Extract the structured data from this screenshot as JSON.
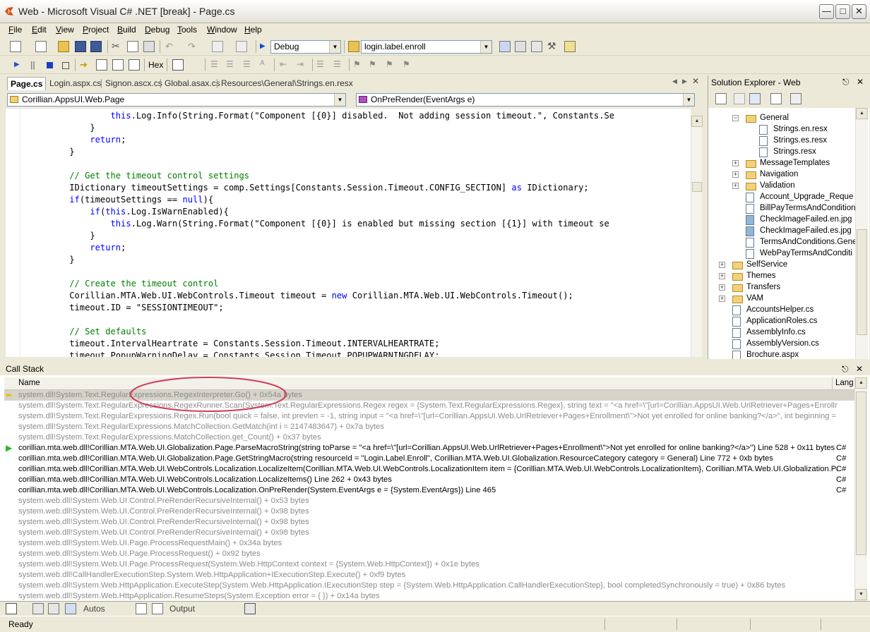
{
  "window": {
    "title": "Web - Microsoft Visual C# .NET [break] - Page.cs"
  },
  "menu": [
    {
      "label": "File",
      "u": "F",
      "rest": "ile"
    },
    {
      "label": "Edit",
      "u": "E",
      "rest": "dit"
    },
    {
      "label": "View",
      "u": "V",
      "rest": "iew"
    },
    {
      "label": "Project",
      "u": "P",
      "rest": "roject"
    },
    {
      "label": "Build",
      "u": "B",
      "rest": "uild"
    },
    {
      "label": "Debug",
      "u": "D",
      "rest": "ebug"
    },
    {
      "label": "Tools",
      "u": "T",
      "rest": "ools"
    },
    {
      "label": "Window",
      "u": "W",
      "rest": "indow"
    },
    {
      "label": "Help",
      "u": "H",
      "rest": "elp"
    }
  ],
  "toolbar": {
    "config_value": "Debug",
    "find_value": "login.label.enroll",
    "hex_label": "Hex"
  },
  "tabs": [
    "Page.cs",
    "Login.aspx.cs",
    "Signon.ascx.cs",
    "Global.asax.cs",
    "Resources\\General\\Strings.en.resx"
  ],
  "navbar": {
    "type_value": "Corillian.AppsUI.Web.Page",
    "member_value": "OnPreRender(EventArgs e)"
  },
  "code_lines": [
    [
      [
        "                ",
        ""
      ],
      [
        "this",
        "kw"
      ],
      [
        ".Log.Info(String.Format(\"Component [{0}] disabled.  Not adding session timeout.\", Constants.Se",
        ""
      ]
    ],
    [
      [
        "            }",
        ""
      ]
    ],
    [
      [
        "            ",
        ""
      ],
      [
        "return",
        "kw"
      ],
      [
        ";",
        ""
      ]
    ],
    [
      [
        "        }",
        ""
      ]
    ],
    [
      [
        "",
        ""
      ]
    ],
    [
      [
        "        ",
        ""
      ],
      [
        "// Get the timeout control settings",
        "cm"
      ]
    ],
    [
      [
        "        IDictionary timeoutSettings = comp.Settings[Constants.Session.Timeout.CONFIG_SECTION] ",
        ""
      ],
      [
        "as",
        "kw"
      ],
      [
        " IDictionary;",
        ""
      ]
    ],
    [
      [
        "        ",
        ""
      ],
      [
        "if",
        "kw"
      ],
      [
        "(timeoutSettings == ",
        ""
      ],
      [
        "null",
        "kw"
      ],
      [
        "){",
        ""
      ]
    ],
    [
      [
        "            ",
        ""
      ],
      [
        "if",
        "kw"
      ],
      [
        "(",
        ""
      ],
      [
        "this",
        "kw"
      ],
      [
        ".Log.IsWarnEnabled){",
        ""
      ]
    ],
    [
      [
        "                ",
        ""
      ],
      [
        "this",
        "kw"
      ],
      [
        ".Log.Warn(String.Format(\"Component [{0}] is enabled but missing section [{1}] with timeout se",
        ""
      ]
    ],
    [
      [
        "            }",
        ""
      ]
    ],
    [
      [
        "            ",
        ""
      ],
      [
        "return",
        "kw"
      ],
      [
        ";",
        ""
      ]
    ],
    [
      [
        "        }",
        ""
      ]
    ],
    [
      [
        "",
        ""
      ]
    ],
    [
      [
        "        ",
        ""
      ],
      [
        "// Create the timeout control",
        "cm"
      ]
    ],
    [
      [
        "        Corillian.MTA.Web.UI.WebControls.Timeout timeout = ",
        ""
      ],
      [
        "new",
        "kw"
      ],
      [
        " Corillian.MTA.Web.UI.WebControls.Timeout();",
        ""
      ]
    ],
    [
      [
        "        timeout.ID = \"SESSIONTIMEOUT\";",
        ""
      ]
    ],
    [
      [
        "",
        ""
      ]
    ],
    [
      [
        "        ",
        ""
      ],
      [
        "// Set defaults",
        "cm"
      ]
    ],
    [
      [
        "        timeout.IntervalHeartrate = Constants.Session.Timeout.INTERVALHEARTRATE;",
        ""
      ]
    ],
    [
      [
        "        timeout.PopupWarningDelay = Constants.Session.Timeout.POPUPWARNINGDELAY;",
        ""
      ]
    ]
  ],
  "solution_explorer": {
    "title": "Solution Explorer - Web",
    "items": [
      {
        "label": "General",
        "kind": "folder",
        "indent": 3,
        "exp": "minus"
      },
      {
        "label": "Strings.en.resx",
        "kind": "file",
        "indent": 4
      },
      {
        "label": "Strings.es.resx",
        "kind": "file",
        "indent": 4
      },
      {
        "label": "Strings.resx",
        "kind": "file",
        "indent": 4
      },
      {
        "label": "MessageTemplates",
        "kind": "folder",
        "indent": 3,
        "exp": "plus"
      },
      {
        "label": "Navigation",
        "kind": "folder",
        "indent": 3,
        "exp": "plus"
      },
      {
        "label": "Validation",
        "kind": "folder",
        "indent": 3,
        "exp": "plus"
      },
      {
        "label": "Account_Upgrade_Reque",
        "kind": "file",
        "indent": 3
      },
      {
        "label": "BillPayTermsAndCondition",
        "kind": "file",
        "indent": 3
      },
      {
        "label": "CheckImageFailed.en.jpg",
        "kind": "image",
        "indent": 3
      },
      {
        "label": "CheckImageFailed.es.jpg",
        "kind": "image",
        "indent": 3
      },
      {
        "label": "TermsAndConditions.Gene",
        "kind": "file",
        "indent": 3
      },
      {
        "label": "WebPayTermsAndConditi",
        "kind": "file",
        "indent": 3
      },
      {
        "label": "SelfService",
        "kind": "folder",
        "indent": 2,
        "exp": "plus"
      },
      {
        "label": "Themes",
        "kind": "folder",
        "indent": 2,
        "exp": "plus"
      },
      {
        "label": "Transfers",
        "kind": "folder",
        "indent": 2,
        "exp": "plus"
      },
      {
        "label": "VAM",
        "kind": "folder",
        "indent": 2,
        "exp": "plus"
      },
      {
        "label": "AccountsHelper.cs",
        "kind": "file",
        "indent": 2
      },
      {
        "label": "ApplicationRoles.cs",
        "kind": "file",
        "indent": 2
      },
      {
        "label": "AssemblyInfo.cs",
        "kind": "file",
        "indent": 2
      },
      {
        "label": "AssemblyVersion.cs",
        "kind": "file",
        "indent": 2
      },
      {
        "label": "Brochure.aspx",
        "kind": "file",
        "indent": 2
      }
    ]
  },
  "call_stack": {
    "title": "Call Stack",
    "col_name": "Name",
    "col_lang": "Lang",
    "rows": [
      {
        "text": "system.dll!System.Text.RegularExpressions.RegexInterpreter.Go() + 0x54a bytes",
        "lang": "",
        "style": "grey",
        "marker": "current"
      },
      {
        "text": "system.dll!System.Text.RegularExpressions.RegexRunner.Scan(System.Text.RegularExpressions.Regex regex = {System.Text.RegularExpressions.Regex}, string text = \"<a href=\\\"[url=Corillian.AppsUI.Web.UrlRetriever+Pages+Enrollme",
        "lang": "",
        "style": "grey"
      },
      {
        "text": "system.dll!System.Text.RegularExpressions.Regex.Run(bool quick = false, int prevlen = -1, string input = \"<a href=\\\"[url=Corillian.AppsUI.Web.UrlRetriever+Pages+Enrollment\\\">Not yet enrolled for online banking?</a>\", int beginning = 0",
        "lang": "",
        "style": "grey"
      },
      {
        "text": "system.dll!System.Text.RegularExpressions.MatchCollection.GetMatch(int i = 2147483647) + 0x7a bytes",
        "lang": "",
        "style": "grey"
      },
      {
        "text": "system.dll!System.Text.RegularExpressions.MatchCollection.get_Count() + 0x37 bytes",
        "lang": "",
        "style": "grey"
      },
      {
        "text": "corillian.mta.web.dll!Corillian.MTA.Web.UI.Globalization.Page.ParseMacroString(string toParse = \"<a href=\\\"[url=Corillian.AppsUI.Web.UrlRetriever+Pages+Enrollment\\\">Not yet enrolled for online banking?</a>\") Line 528 + 0x11 bytes",
        "lang": "C#",
        "style": "",
        "marker": "frame"
      },
      {
        "text": "corillian.mta.web.dll!Corillian.MTA.Web.UI.Globalization.Page.GetStringMacro(string resourceId = \"Login.Label.Enroll\", Corillian.MTA.Web.UI.Globalization.ResourceCategory category = General) Line 772 + 0xb bytes",
        "lang": "C#",
        "style": ""
      },
      {
        "text": "corillian.mta.web.dll!Corillian.MTA.Web.UI.WebControls.Localization.LocalizeItem(Corillian.MTA.Web.UI.WebControls.LocalizationItem item = {Corillian.MTA.Web.UI.WebControls.LocalizationItem}, Corillian.MTA.Web.UI.Globalization.Page p",
        "lang": "C#",
        "style": ""
      },
      {
        "text": "corillian.mta.web.dll!Corillian.MTA.Web.UI.WebControls.Localization.LocalizeItems() Line 262 + 0x43 bytes",
        "lang": "C#",
        "style": ""
      },
      {
        "text": "corillian.mta.web.dll!Corillian.MTA.Web.UI.WebControls.Localization.OnPreRender(System.EventArgs e = {System.EventArgs}) Line 465",
        "lang": "C#",
        "style": ""
      },
      {
        "text": "system.web.dll!System.Web.UI.Control.PreRenderRecursiveInternal() + 0x53 bytes",
        "lang": "",
        "style": "grey"
      },
      {
        "text": "system.web.dll!System.Web.UI.Control.PreRenderRecursiveInternal() + 0x98 bytes",
        "lang": "",
        "style": "grey"
      },
      {
        "text": "system.web.dll!System.Web.UI.Control.PreRenderRecursiveInternal() + 0x98 bytes",
        "lang": "",
        "style": "grey"
      },
      {
        "text": "system.web.dll!System.Web.UI.Control.PreRenderRecursiveInternal() + 0x98 bytes",
        "lang": "",
        "style": "grey"
      },
      {
        "text": "system.web.dll!System.Web.UI.Page.ProcessRequestMain() + 0x34a bytes",
        "lang": "",
        "style": "grey"
      },
      {
        "text": "system.web.dll!System.Web.UI.Page.ProcessRequest() + 0x92 bytes",
        "lang": "",
        "style": "grey"
      },
      {
        "text": "system.web.dll!System.Web.UI.Page.ProcessRequest(System.Web.HttpContext context = {System.Web.HttpContext}) + 0x1e bytes",
        "lang": "",
        "style": "grey"
      },
      {
        "text": "system.web.dll!CallHandlerExecutionStep.System.Web.HttpApplication+IExecutionStep.Execute() + 0xf9 bytes",
        "lang": "",
        "style": "grey"
      },
      {
        "text": "system.web.dll!System.Web.HttpApplication.ExecuteStep(System.Web.HttpApplication.IExecutionStep step = {System.Web.HttpApplication.CallHandlerExecutionStep}, bool completedSynchronously = true) + 0x86 bytes",
        "lang": "",
        "style": "grey"
      },
      {
        "text": "system.web.dll!System.Web.HttpApplication.ResumeSteps(System.Exception error = { }) + 0x14a bytes",
        "lang": "",
        "style": "grey"
      }
    ]
  },
  "bottom_tabs": {
    "autos": "Autos",
    "output": "Output"
  },
  "status": {
    "text": "Ready"
  },
  "colors": {
    "keyword": "#0000ff",
    "comment": "#008000",
    "highlight_ellipse": "#d23c5a"
  }
}
